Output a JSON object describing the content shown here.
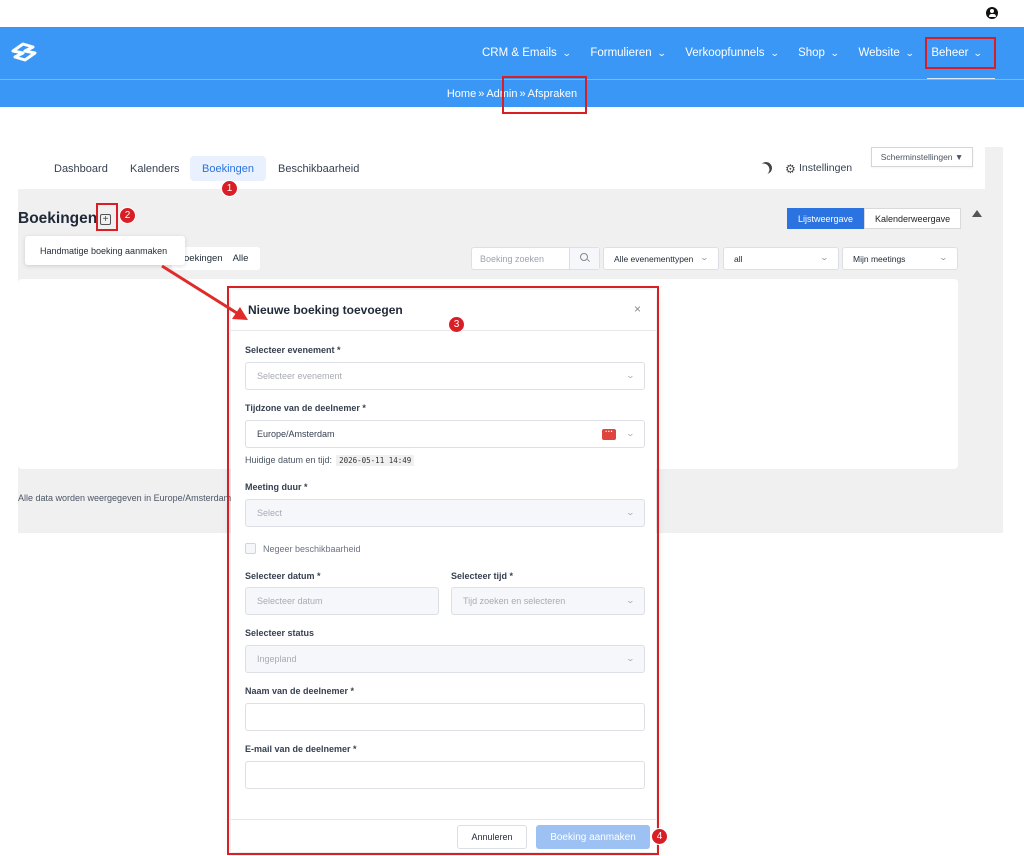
{
  "nav": {
    "items": [
      {
        "label": "CRM & Emails"
      },
      {
        "label": "Formulieren"
      },
      {
        "label": "Verkoopfunnels"
      },
      {
        "label": "Shop"
      },
      {
        "label": "Website"
      },
      {
        "label": "Beheer"
      }
    ]
  },
  "breadcrumb": {
    "home": "Home",
    "sep1": "»",
    "admin": "Admin",
    "sep2": "»",
    "current": "Afspraken"
  },
  "tabs": [
    "Dashboard",
    "Kalenders",
    "Boekingen",
    "Beschikbaarheid"
  ],
  "header": {
    "settings": "Instellingen",
    "screen_settings": "Scherminstellingen ▼"
  },
  "page": {
    "title": "Boekingen",
    "plus": "+"
  },
  "views": {
    "list": "Lijstweergave",
    "calendar": "Kalenderweergave"
  },
  "tooltip": "Handmatige boeking aanmaken",
  "filters": {
    "left1": "oekingen",
    "left2": "Alle",
    "search_placeholder": "Boeking zoeken",
    "event_types": "Alle evenementtypen",
    "status": "all",
    "meetings": "Mijn meetings"
  },
  "footer_note": "Alle data worden weergegeven in Europe/Amsterdam",
  "modal": {
    "title": "Nieuwe boeking toevoegen",
    "close": "×",
    "event_label": "Selecteer evenement *",
    "event_placeholder": "Selecteer evenement",
    "tz_label": "Tijdzone van de deelnemer *",
    "tz_value": "Europe/Amsterdam",
    "now_label": "Huidige datum en tijd:",
    "now_value": "2026-05-11 14:49",
    "duration_label": "Meeting duur *",
    "duration_placeholder": "Select",
    "ignore_label": "Negeer beschikbaarheid",
    "date_label": "Selecteer datum *",
    "date_placeholder": "Selecteer datum",
    "time_label": "Selecteer tijd *",
    "time_placeholder": "Tijd zoeken en selecteren",
    "status_label": "Selecteer status",
    "status_value": "Ingepland",
    "name_label": "Naam van de deelnemer *",
    "email_label": "E-mail van de deelnemer *",
    "cancel": "Annuleren",
    "create": "Boeking aanmaken"
  },
  "markers": [
    "1",
    "2",
    "3",
    "4"
  ],
  "colors": {
    "nav_blue": "#3b97f6",
    "annotation_red": "#d91f26",
    "primary": "#2a73e0"
  }
}
